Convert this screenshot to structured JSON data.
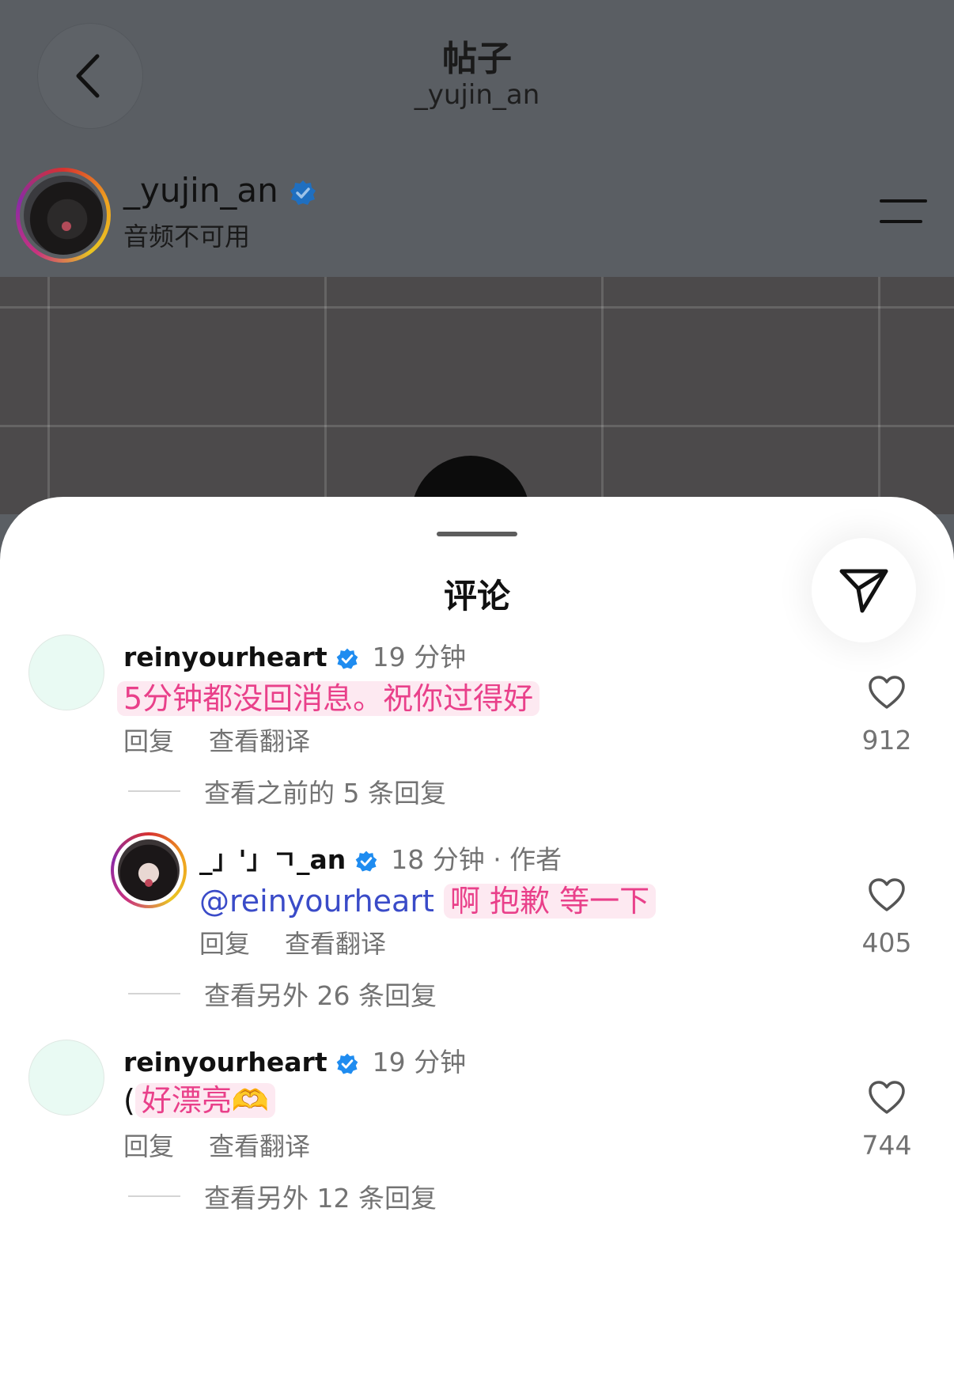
{
  "header": {
    "title": "帖子",
    "subtitle": "_yujin_an"
  },
  "post_author": {
    "username": "_yujin_an",
    "status": "音频不可用"
  },
  "comments_sheet": {
    "title": "评论",
    "comments": [
      {
        "username": "reinyourheart",
        "time": "19 分钟",
        "text": "5分钟都没回消息。祝你过得好",
        "reply_label": "回复",
        "translate_label": "查看翻译",
        "likes": "912",
        "more_replies": "查看之前的 5 条回复"
      },
      {
        "username": "_」'」ㄱ_an",
        "time": "18 分钟 · 作者",
        "mention": "@reinyourheart",
        "text": "啊 抱歉 等一下",
        "reply_label": "回复",
        "translate_label": "查看翻译",
        "likes": "405",
        "more_replies": "查看另外 26 条回复"
      },
      {
        "username": "reinyourheart",
        "time": "19 分钟",
        "text_prefix": "(",
        "text": "好漂亮🫶",
        "reply_label": "回复",
        "translate_label": "查看翻译",
        "likes": "744",
        "more_replies": "查看另外 12 条回复"
      }
    ]
  },
  "colors": {
    "highlight_bg": "#fde9f1",
    "highlight_text": "#e9408a",
    "mention": "#3a4bc8",
    "verified": "#1f8cf0",
    "secondary_text": "#737373"
  },
  "icons": [
    "chevron-left-icon",
    "verified-badge-icon",
    "menu-icon",
    "send-icon",
    "heart-icon"
  ]
}
